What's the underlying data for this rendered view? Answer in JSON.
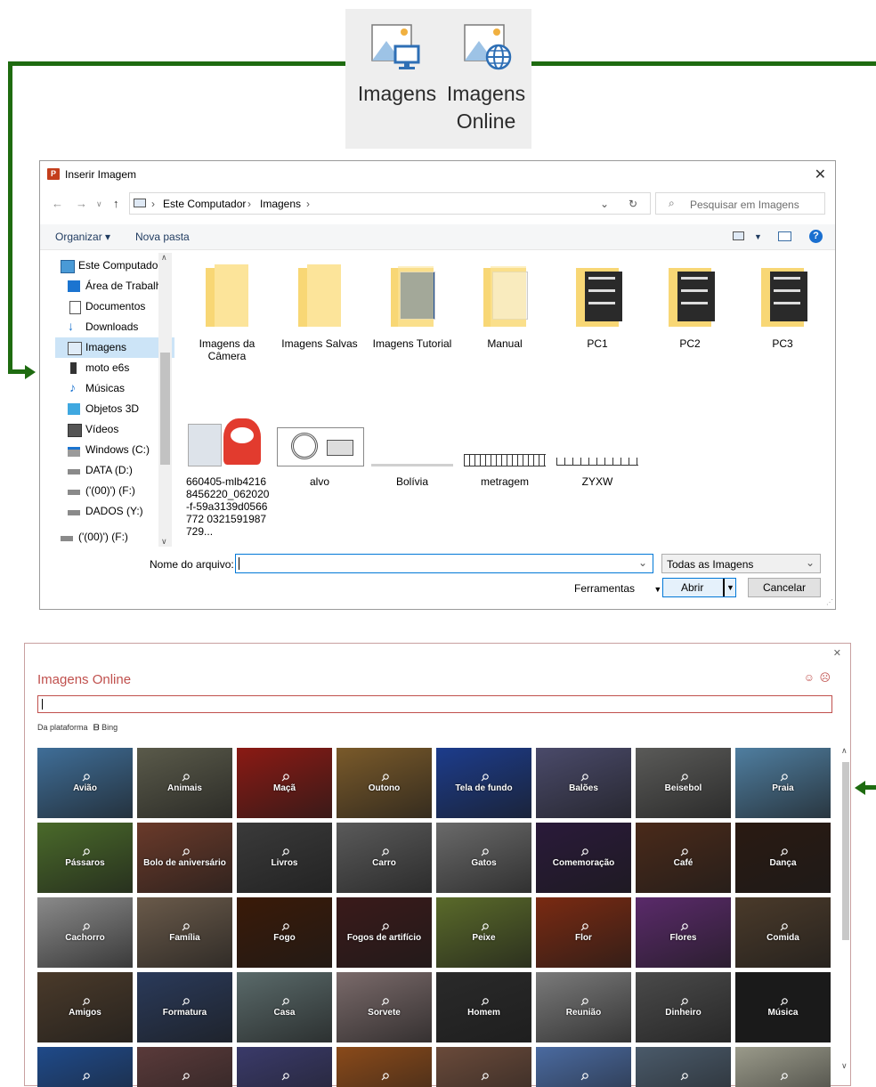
{
  "ribbon": {
    "imagens_label": "Imagens",
    "online_label_1": "Imagens",
    "online_label_2": "Online"
  },
  "insert_dialog": {
    "title": "Inserir Imagem",
    "breadcrumb": [
      "Este Computador",
      "Imagens"
    ],
    "search_placeholder": "Pesquisar em Imagens",
    "toolbar": {
      "organize": "Organizar",
      "new_folder": "Nova pasta"
    },
    "sidebar": [
      {
        "label": "Este Computador",
        "icon": "computer-icon"
      },
      {
        "label": "Área de Trabalho",
        "icon": "desktop-icon"
      },
      {
        "label": "Documentos",
        "icon": "documents-icon"
      },
      {
        "label": "Downloads",
        "icon": "downloads-icon"
      },
      {
        "label": "Imagens",
        "icon": "pictures-icon",
        "selected": true
      },
      {
        "label": "moto e6s",
        "icon": "phone-icon"
      },
      {
        "label": "Músicas",
        "icon": "music-icon"
      },
      {
        "label": "Objetos 3D",
        "icon": "objects3d-icon"
      },
      {
        "label": "Vídeos",
        "icon": "videos-icon"
      },
      {
        "label": "Windows (C:)",
        "icon": "windows-drive-icon"
      },
      {
        "label": "DATA (D:)",
        "icon": "drive-icon"
      },
      {
        "label": "('(00)') (F:)",
        "icon": "drive-icon"
      },
      {
        "label": "DADOS (Y:)",
        "icon": "drive-icon"
      },
      {
        "label": "('(00)') (F:)",
        "icon": "drive-icon"
      }
    ],
    "files": [
      {
        "name": "Imagens da Câmera",
        "kind": "folder"
      },
      {
        "name": "Imagens Salvas",
        "kind": "folder"
      },
      {
        "name": "Imagens Tutorial",
        "kind": "folder-doc"
      },
      {
        "name": "Manual",
        "kind": "folder-doc"
      },
      {
        "name": "PC1",
        "kind": "folder-dark"
      },
      {
        "name": "PC2",
        "kind": "folder-dark"
      },
      {
        "name": "PC3",
        "kind": "folder-dark"
      },
      {
        "name": "660405-mlb42168456220_062020-f-59a3139d0566772 0321591987729...",
        "kind": "image-toy"
      },
      {
        "name": "alvo",
        "kind": "image-target"
      },
      {
        "name": "Bolívia",
        "kind": "image-line"
      },
      {
        "name": "metragem",
        "kind": "image-ruler"
      },
      {
        "name": "ZYXW",
        "kind": "image-ruler2"
      }
    ],
    "filename_label": "Nome do arquivo:",
    "filename_value": "",
    "filter_value": "Todas as Imagens",
    "tools_label": "Ferramentas",
    "open_label": "Abrir",
    "cancel_label": "Cancelar"
  },
  "online_dialog": {
    "title": "Imagens Online",
    "source_prefix": "Da plataforma",
    "source_name": "Bing",
    "search_value": "",
    "categories": [
      {
        "label": "Avião",
        "color": "#3f6e98"
      },
      {
        "label": "Animais",
        "color": "#5a5a4a"
      },
      {
        "label": "Maçã",
        "color": "#8b1a14"
      },
      {
        "label": "Outono",
        "color": "#7a5a2a"
      },
      {
        "label": "Tela de fundo",
        "color": "#1c3c8c"
      },
      {
        "label": "Balões",
        "color": "#4a4a6a"
      },
      {
        "label": "Beisebol",
        "color": "#5a5a58"
      },
      {
        "label": "Praia",
        "color": "#4f7ea0"
      },
      {
        "label": "Pássaros",
        "color": "#4a6a2a"
      },
      {
        "label": "Bolo de aniversário",
        "color": "#6a3a2a"
      },
      {
        "label": "Livros",
        "color": "#3a3a3a"
      },
      {
        "label": "Carro",
        "color": "#5a5a5a"
      },
      {
        "label": "Gatos",
        "color": "#6a6a6a"
      },
      {
        "label": "Comemoração",
        "color": "#2a1a3a"
      },
      {
        "label": "Café",
        "color": "#4a2a1a"
      },
      {
        "label": "Dança",
        "color": "#2a1a12"
      },
      {
        "label": "Cachorro",
        "color": "#8a8a8a"
      },
      {
        "label": "Família",
        "color": "#6a5a4a"
      },
      {
        "label": "Fogo",
        "color": "#3a1a08"
      },
      {
        "label": "Fogos de artifício",
        "color": "#3a1a1a"
      },
      {
        "label": "Peixe",
        "color": "#5a6a2a"
      },
      {
        "label": "Flor",
        "color": "#7a2a12"
      },
      {
        "label": "Flores",
        "color": "#5a2a6a"
      },
      {
        "label": "Comida",
        "color": "#4a3a2a"
      },
      {
        "label": "Amigos",
        "color": "#4a3a2a"
      },
      {
        "label": "Formatura",
        "color": "#2a3a5a"
      },
      {
        "label": "Casa",
        "color": "#5a6a6a"
      },
      {
        "label": "Sorvete",
        "color": "#7a6a6a"
      },
      {
        "label": "Homem",
        "color": "#2a2a2a"
      },
      {
        "label": "Reunião",
        "color": "#7a7a7a"
      },
      {
        "label": "Dinheiro",
        "color": "#4a4a4a"
      },
      {
        "label": "Música",
        "color": "#1a1a1a"
      },
      {
        "label": "",
        "color": "#1f4a8a"
      },
      {
        "label": "",
        "color": "#5a3a3a"
      },
      {
        "label": "",
        "color": "#3a3a6a"
      },
      {
        "label": "",
        "color": "#8a4a1a"
      },
      {
        "label": "",
        "color": "#6a4a3a"
      },
      {
        "label": "",
        "color": "#4a6aa0"
      },
      {
        "label": "",
        "color": "#4a5a6a"
      },
      {
        "label": "",
        "color": "#9a9a8a"
      }
    ]
  }
}
